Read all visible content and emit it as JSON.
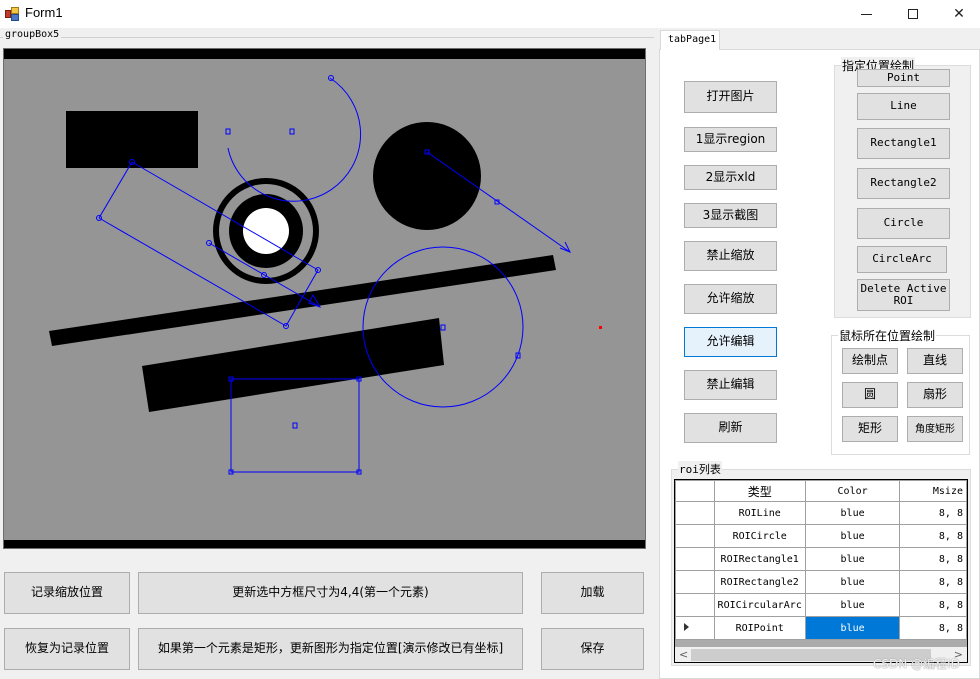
{
  "window": {
    "title": "Form1",
    "controls": {
      "minimize": "minimize",
      "maximize": "maximize",
      "close": "close"
    }
  },
  "left_panel": {
    "groupbox_label": "groupBox5",
    "canvas": {
      "background": "#959595",
      "roi_color": "#0000ff",
      "cursor_marker_color": "#ff0000"
    },
    "buttons": {
      "record_zoom": "记录缩放位置",
      "restore_zoom": "恢复为记录位置",
      "update_box_size": "更新选中方框尺寸为4,4(第一个元素)",
      "update_rect_position": "如果第一个元素是矩形，更新图形为指定位置[演示修改已有坐标]",
      "load": "加载",
      "save": "保存"
    }
  },
  "right_panel": {
    "tab_label": "tabPage1",
    "actions": [
      {
        "label": "打开图片",
        "active": false
      },
      {
        "label": "1显示region",
        "active": false
      },
      {
        "label": "2显示xld",
        "active": false
      },
      {
        "label": "3显示截图",
        "active": false
      },
      {
        "label": "禁止缩放",
        "active": false
      },
      {
        "label": "允许缩放",
        "active": false
      },
      {
        "label": "允许编辑",
        "active": true
      },
      {
        "label": "禁止编辑",
        "active": false
      },
      {
        "label": "刷新",
        "active": false
      }
    ],
    "draw_at_position": {
      "label": "指定位置绘制",
      "buttons": [
        "Point",
        "Line",
        "Rectangle1",
        "Rectangle2",
        "Circle",
        "CircleArc",
        "Delete Active ROI"
      ]
    },
    "draw_at_mouse": {
      "label": "鼠标所在位置绘制",
      "buttons": [
        "绘制点",
        "直线",
        "圆",
        "扇形",
        "矩形",
        "角度矩形"
      ]
    },
    "roi_list": {
      "label": "roi列表",
      "columns": [
        "类型",
        "Color",
        "Msize"
      ],
      "rows": [
        {
          "type": "ROILine",
          "color": "blue",
          "msize": "8, 8",
          "current": false
        },
        {
          "type": "ROICircle",
          "color": "blue",
          "msize": "8, 8",
          "current": false
        },
        {
          "type": "ROIRectangle1",
          "color": "blue",
          "msize": "8, 8",
          "current": false
        },
        {
          "type": "ROIRectangle2",
          "color": "blue",
          "msize": "8, 8",
          "current": false
        },
        {
          "type": "ROICircularArc",
          "color": "blue",
          "msize": "8, 8",
          "current": false
        },
        {
          "type": "ROIPoint",
          "color": "blue",
          "msize": "8, 8",
          "current": true
        }
      ],
      "selected_cell_color": "#0078d7"
    }
  },
  "watermark": "CSDN @编程ID"
}
